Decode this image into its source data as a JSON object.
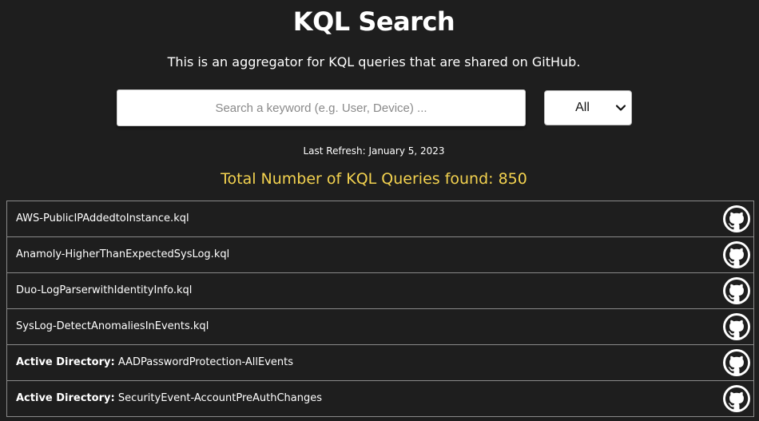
{
  "header": {
    "title": "KQL Search",
    "subtitle": "This is an aggregator for KQL queries that are shared on GitHub."
  },
  "search": {
    "placeholder": "Search a keyword (e.g. User, Device) ...",
    "value": ""
  },
  "filter": {
    "selected": "All",
    "icon": "chevron-down-icon"
  },
  "meta": {
    "last_refresh": "Last Refresh: January 5, 2023",
    "total": "Total Number of KQL Queries found: 850"
  },
  "colors": {
    "background": "#1e1e1e",
    "accent": "#f3d24f",
    "border": "#8a8a8a"
  },
  "results": [
    {
      "category": "",
      "name": "AWS-PublicIPAddedtoInstance.kql",
      "icon": "github-icon"
    },
    {
      "category": "",
      "name": "Anamoly-HigherThanExpectedSysLog.kql",
      "icon": "github-icon"
    },
    {
      "category": "",
      "name": "Duo-LogParserwithIdentityInfo.kql",
      "icon": "github-icon"
    },
    {
      "category": "",
      "name": "SysLog-DetectAnomaliesInEvents.kql",
      "icon": "github-icon"
    },
    {
      "category": "Active Directory:",
      "name": "AADPasswordProtection-AllEvents",
      "icon": "github-icon"
    },
    {
      "category": "Active Directory:",
      "name": "SecurityEvent-AccountPreAuthChanges",
      "icon": "github-icon"
    }
  ]
}
